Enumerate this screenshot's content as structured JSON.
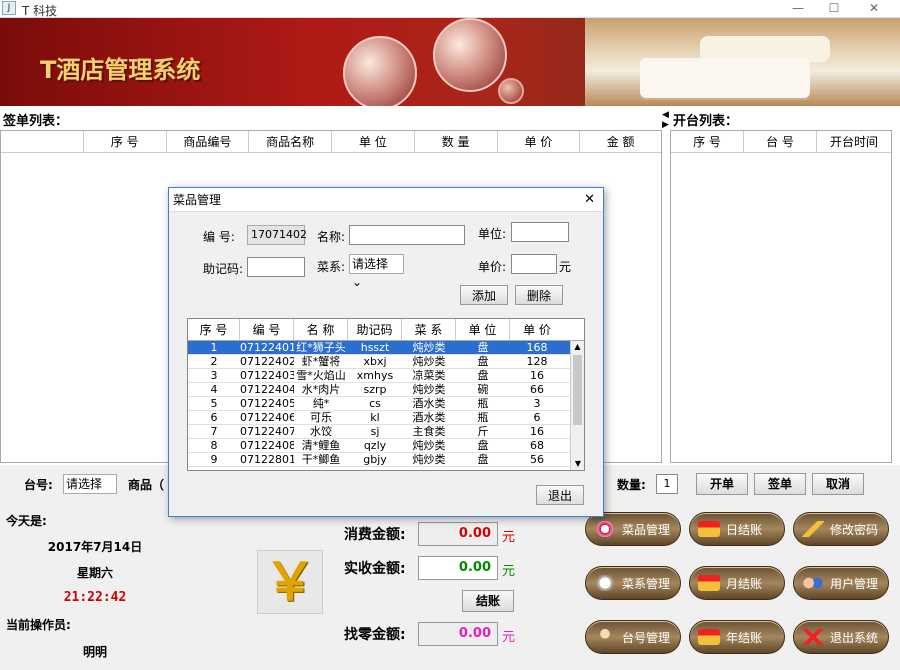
{
  "window": {
    "title": "T 科技",
    "min": "—",
    "max": "☐",
    "close": "✕"
  },
  "banner": {
    "logo": "T酒店管理系统"
  },
  "sign_list": {
    "label": "签单列表：",
    "columns": [
      "",
      "序 号",
      "商品编号",
      "商品名称",
      "单 位",
      "数 量",
      "单 价",
      "金 额"
    ]
  },
  "open_list": {
    "label": "开台列表：",
    "columns": [
      "序 号",
      "台 号",
      "开台时间"
    ]
  },
  "order_bar": {
    "table_label": "台号:",
    "table_select": "请选择",
    "goods_label": "商品（",
    "qty_label": "数量:",
    "qty_value": "1",
    "open_btn": "开单",
    "sign_btn": "签单",
    "cancel_btn": "取消"
  },
  "info": {
    "today_label": "今天是:",
    "date": "2017年7月14日",
    "weekday": "星期六",
    "time": "21:22:42",
    "operator_label": "当前操作员:",
    "operator": "明明"
  },
  "money": {
    "consume_label": "消费金额:",
    "consume_value": "0.00",
    "received_label": "实收金额:",
    "received_value": "0.00",
    "settle_btn": "结账",
    "change_label": "找零金额:",
    "change_value": "0.00",
    "unit": "元",
    "yen_symbol": "￥"
  },
  "menu": [
    {
      "label": "菜品管理",
      "icon": "dish-icon"
    },
    {
      "label": "日结账",
      "icon": "daily-icon"
    },
    {
      "label": "修改密码",
      "icon": "key-icon"
    },
    {
      "label": "菜系管理",
      "icon": "category-icon"
    },
    {
      "label": "月结账",
      "icon": "monthly-icon"
    },
    {
      "label": "用户管理",
      "icon": "users-icon"
    },
    {
      "label": "台号管理",
      "icon": "table-icon"
    },
    {
      "label": "年结账",
      "icon": "yearly-icon"
    },
    {
      "label": "退出系统",
      "icon": "exit-icon"
    }
  ],
  "dialog": {
    "title": "菜品管理",
    "close": "✕",
    "id_label": "编 号:",
    "id_value": "17071402",
    "name_label": "名称:",
    "unit_label": "单位:",
    "code_label": "助记码:",
    "category_label": "菜系:",
    "category_select": "请选择",
    "price_label": "单价:",
    "price_unit": "元",
    "add_btn": "添加",
    "delete_btn": "删除",
    "exit_btn": "退出",
    "columns": [
      "序 号",
      "编 号",
      "名 称",
      "助记码",
      "菜 系",
      "单 位",
      "单 价"
    ],
    "rows": [
      [
        "1",
        "07122401",
        "红*狮子头",
        "hsszt",
        "炖炒类",
        "盘",
        "168"
      ],
      [
        "2",
        "07122402",
        "虾*蟹将",
        "xbxj",
        "炖炒类",
        "盘",
        "128"
      ],
      [
        "3",
        "07122403",
        "雪*火焰山",
        "xmhys",
        "凉菜类",
        "盘",
        "16"
      ],
      [
        "4",
        "07122404",
        "水*肉片",
        "szrp",
        "炖炒类",
        "碗",
        "66"
      ],
      [
        "5",
        "07122405",
        "纯*",
        "cs",
        "酒水类",
        "瓶",
        "3"
      ],
      [
        "6",
        "07122406",
        "可乐",
        "kl",
        "酒水类",
        "瓶",
        "6"
      ],
      [
        "7",
        "07122407",
        "水饺",
        "sj",
        "主食类",
        "斤",
        "16"
      ],
      [
        "8",
        "07122408",
        "清*鲤鱼",
        "qzly",
        "炖炒类",
        "盘",
        "68"
      ],
      [
        "9",
        "07122801",
        "干*鲫鱼",
        "gbjy",
        "炖炒类",
        "盘",
        "56"
      ]
    ]
  },
  "colors": {
    "accent": "#2a6fd0",
    "money_red": "#d40000",
    "money_green": "#008a00",
    "money_pink": "#e020c0",
    "time_red": "#d00000"
  }
}
